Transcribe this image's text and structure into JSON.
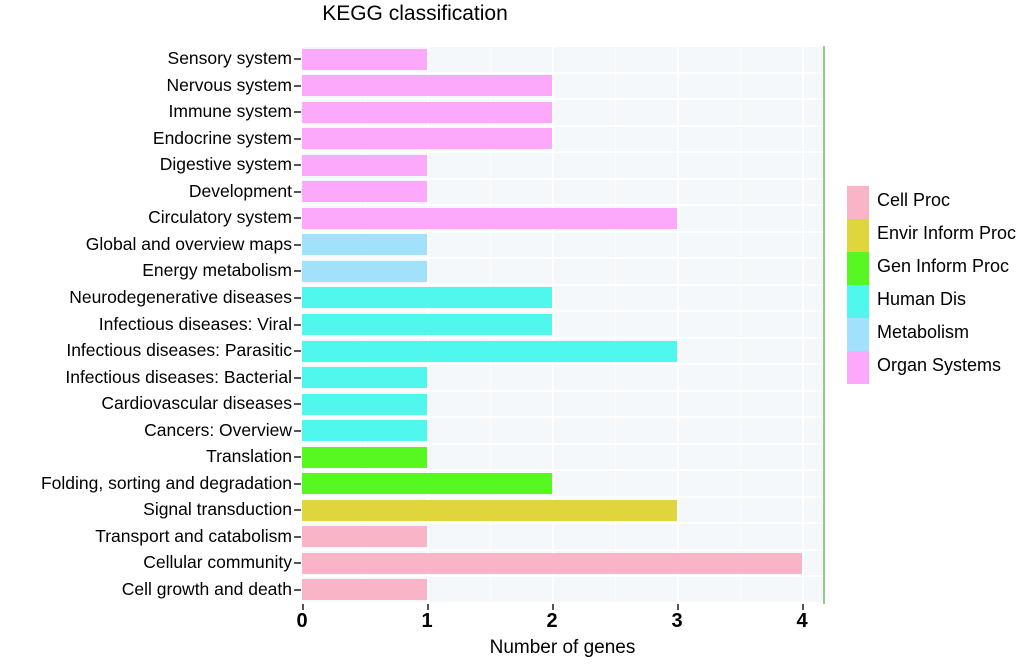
{
  "chart_data": {
    "type": "bar",
    "orientation": "horizontal",
    "title": "KEGG classification",
    "xlabel": "Number of genes",
    "ylabel": "",
    "xlim": [
      0,
      4.16
    ],
    "xticks": [
      0,
      1,
      2,
      3,
      4
    ],
    "xticklabels": [
      "0",
      "1",
      "2",
      "3",
      "4"
    ],
    "grid": true,
    "legend_position": "right",
    "categories": [
      "Sensory system",
      "Nervous system",
      "Immune system",
      "Endocrine system",
      "Digestive system",
      "Development",
      "Circulatory system",
      "Global and overview maps",
      "Energy metabolism",
      "Neurodegenerative diseases",
      "Infectious diseases: Viral",
      "Infectious diseases: Parasitic",
      "Infectious diseases: Bacterial",
      "Cardiovascular diseases",
      "Cancers: Overview",
      "Translation",
      "Folding, sorting and degradation",
      "Signal transduction",
      "Transport and catabolism",
      "Cellular community",
      "Cell growth and death"
    ],
    "values": [
      1,
      2,
      2,
      2,
      1,
      1,
      3,
      1,
      1,
      2,
      2,
      3,
      1,
      1,
      1,
      1,
      2,
      3,
      1,
      4,
      1
    ],
    "groups": [
      "Organ Systems",
      "Organ Systems",
      "Organ Systems",
      "Organ Systems",
      "Organ Systems",
      "Organ Systems",
      "Organ Systems",
      "Metabolism",
      "Metabolism",
      "Human Dis",
      "Human Dis",
      "Human Dis",
      "Human Dis",
      "Human Dis",
      "Human Dis",
      "Gen Inform Proc",
      "Gen Inform Proc",
      "Envir Inform Proc",
      "Cell Proc",
      "Cell Proc",
      "Cell Proc"
    ],
    "series": [
      {
        "name": "Cell Proc",
        "color": "#f9b4c8",
        "categories": [
          "Transport and catabolism",
          "Cellular community",
          "Cell growth and death"
        ],
        "values": [
          1,
          4,
          1
        ]
      },
      {
        "name": "Envir Inform Proc",
        "color": "#dfd53c",
        "categories": [
          "Signal transduction"
        ],
        "values": [
          3
        ]
      },
      {
        "name": "Gen Inform Proc",
        "color": "#57f722",
        "categories": [
          "Translation",
          "Folding, sorting and degradation"
        ],
        "values": [
          1,
          2
        ]
      },
      {
        "name": "Human Dis",
        "color": "#4ff7ec",
        "categories": [
          "Neurodegenerative diseases",
          "Infectious diseases: Viral",
          "Infectious diseases: Parasitic",
          "Infectious diseases: Bacterial",
          "Cardiovascular diseases",
          "Cancers: Overview"
        ],
        "values": [
          2,
          2,
          3,
          1,
          1,
          1
        ]
      },
      {
        "name": "Metabolism",
        "color": "#a2e1fb",
        "categories": [
          "Global and overview maps",
          "Energy metabolism"
        ],
        "values": [
          1,
          1
        ]
      },
      {
        "name": "Organ Systems",
        "color": "#fda9fb",
        "categories": [
          "Sensory system",
          "Nervous system",
          "Immune system",
          "Endocrine system",
          "Digestive system",
          "Development",
          "Circulatory system"
        ],
        "values": [
          1,
          2,
          2,
          2,
          1,
          1,
          3
        ]
      }
    ]
  },
  "legend": {
    "entries": [
      {
        "label": "Cell Proc",
        "color": "#f9b4c8"
      },
      {
        "label": "Envir Inform Proc",
        "color": "#dfd53c"
      },
      {
        "label": "Gen Inform Proc",
        "color": "#57f722"
      },
      {
        "label": "Human Dis",
        "color": "#4ff7ec"
      },
      {
        "label": "Metabolism",
        "color": "#a2e1fb"
      },
      {
        "label": "Organ Systems",
        "color": "#fda9fb"
      }
    ]
  },
  "style": {
    "panel_background": "#f4f8fa",
    "gridline_color": "#ffffff",
    "panel_edge_color": "#8fce84",
    "tick_color": "#555555"
  }
}
